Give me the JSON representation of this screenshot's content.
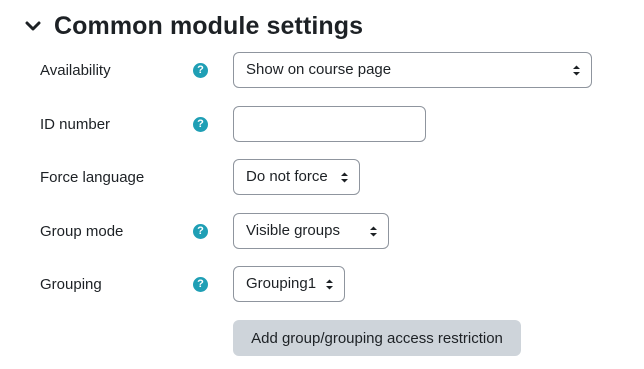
{
  "section": {
    "title": "Common module settings",
    "icon": "chevron-down-icon"
  },
  "fields": {
    "availability": {
      "label": "Availability",
      "value": "Show on course page",
      "help_icon": "question-circle-icon"
    },
    "id_number": {
      "label": "ID number",
      "value": "",
      "placeholder": "",
      "help_icon": "question-circle-icon"
    },
    "force_language": {
      "label": "Force language",
      "value": "Do not force"
    },
    "group_mode": {
      "label": "Group mode",
      "value": "Visible groups",
      "help_icon": "question-circle-icon"
    },
    "grouping": {
      "label": "Grouping",
      "value": "Grouping1",
      "help_icon": "question-circle-icon"
    }
  },
  "actions": {
    "add_restriction_label": "Add group/grouping access restriction"
  },
  "help_glyph": "?",
  "colors": {
    "help_icon": "#1f9fb5",
    "button_bg": "#ced4da",
    "border": "#8f959e",
    "text": "#1d2125"
  }
}
